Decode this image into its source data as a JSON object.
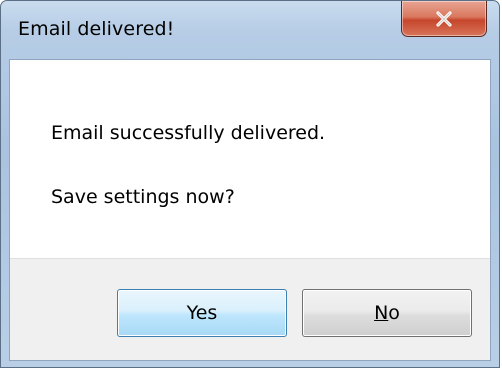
{
  "dialog": {
    "title": "Email delivered!",
    "message_line1": "Email successfully delivered.",
    "message_line2": "Save settings now?"
  },
  "buttons": {
    "yes_label": "Yes",
    "no_accel": "N",
    "no_rest": "o"
  },
  "icons": {
    "close": "close-icon"
  },
  "colors": {
    "close_button": "#c6462c",
    "default_button_border": "#3c7fb1"
  }
}
